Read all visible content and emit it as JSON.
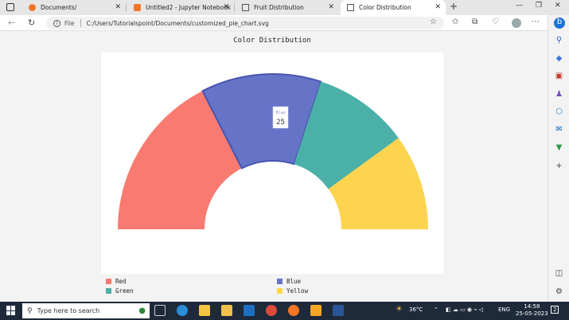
{
  "browser": {
    "tabs": [
      {
        "label": "Documents/",
        "favicon_color": "#f37626"
      },
      {
        "label": "Untitled2 - Jupyter Notebook",
        "favicon_color": "#f37626"
      },
      {
        "label": "Fruit Distribution",
        "favicon_color": "#555555"
      },
      {
        "label": "Color Distribution",
        "favicon_color": "#555555",
        "active": true
      }
    ],
    "address": {
      "scheme_label": "File",
      "url": "C:/Users/Tutorialspoint/Documents/customized_pie_chart.svg"
    }
  },
  "page": {
    "title": "Color Distribution",
    "tooltip": {
      "label": "Blue",
      "value": "25"
    }
  },
  "chart_data": {
    "type": "pie",
    "style": "half-donut",
    "title": "Color Distribution",
    "categories": [
      "Red",
      "Blue",
      "Green",
      "Yellow"
    ],
    "values": [
      35,
      25,
      20,
      20
    ],
    "colors": [
      "#f87a70",
      "#6674c8",
      "#4ab0a8",
      "#fdd44f"
    ],
    "highlighted": "Blue",
    "legend_position": "bottom"
  },
  "legend": [
    {
      "label": "Red",
      "color": "#f87a70"
    },
    {
      "label": "Blue",
      "color": "#6674c8"
    },
    {
      "label": "Green",
      "color": "#4ab0a8"
    },
    {
      "label": "Yellow",
      "color": "#fdd44f"
    }
  ],
  "taskbar": {
    "search_placeholder": "Type here to search",
    "temperature": "36°C",
    "language": "ENG",
    "time": "14:58",
    "date": "25-05-2023",
    "notification_count": "2"
  }
}
